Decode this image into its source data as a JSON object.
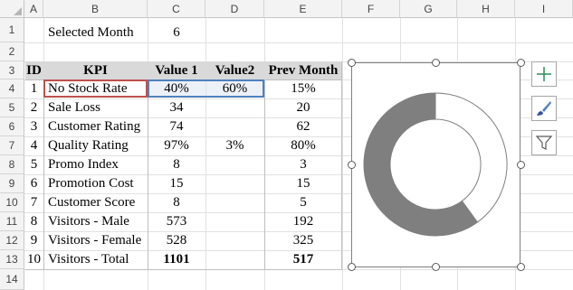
{
  "columns": [
    "A",
    "B",
    "C",
    "D",
    "E",
    "F",
    "G",
    "H",
    "I"
  ],
  "rows": [
    "1",
    "2",
    "3",
    "4",
    "5",
    "6",
    "7",
    "8",
    "9",
    "10",
    "11",
    "12",
    "13",
    "14"
  ],
  "selected_month": {
    "label": "Selected Month",
    "value": "6"
  },
  "table": {
    "headers": [
      "ID",
      "KPI",
      "Value 1",
      "Value2",
      "Prev Month"
    ],
    "rows": [
      {
        "id": "1",
        "kpi": "No Stock Rate",
        "v1": "40%",
        "v2": "60%",
        "prev": "15%"
      },
      {
        "id": "2",
        "kpi": "Sale Loss",
        "v1": "34",
        "v2": "",
        "prev": "20"
      },
      {
        "id": "3",
        "kpi": "Customer Rating",
        "v1": "74",
        "v2": "",
        "prev": "62"
      },
      {
        "id": "4",
        "kpi": "Quality Rating",
        "v1": "97%",
        "v2": "3%",
        "prev": "80%"
      },
      {
        "id": "5",
        "kpi": "Promo Index",
        "v1": "8",
        "v2": "",
        "prev": "3"
      },
      {
        "id": "6",
        "kpi": "Promotion Cost",
        "v1": "15",
        "v2": "",
        "prev": "15"
      },
      {
        "id": "7",
        "kpi": "Customer Score",
        "v1": "8",
        "v2": "",
        "prev": "5"
      },
      {
        "id": "8",
        "kpi": "Visitors - Male",
        "v1": "573",
        "v2": "",
        "prev": "192"
      },
      {
        "id": "9",
        "kpi": "Visitors - Female",
        "v1": "528",
        "v2": "",
        "prev": "325"
      },
      {
        "id": "10",
        "kpi": "Visitors - Total",
        "v1": "1101",
        "v2": "",
        "prev": "517"
      }
    ]
  },
  "chart_data": {
    "type": "pie",
    "categories": [
      "Value 1",
      "Value2"
    ],
    "values": [
      60,
      40
    ],
    "colors": [
      "#7f7f7f",
      "#ffffff"
    ],
    "donut": true
  },
  "side_buttons": [
    {
      "icon": "plus-icon"
    },
    {
      "icon": "brush-icon"
    },
    {
      "icon": "filter-icon"
    }
  ],
  "colors": {
    "header_band": "#d9d9d9",
    "selection_red": "#c0504d",
    "selection_blue": "#4f81bd",
    "donut_fill": "#7f7f7f"
  }
}
